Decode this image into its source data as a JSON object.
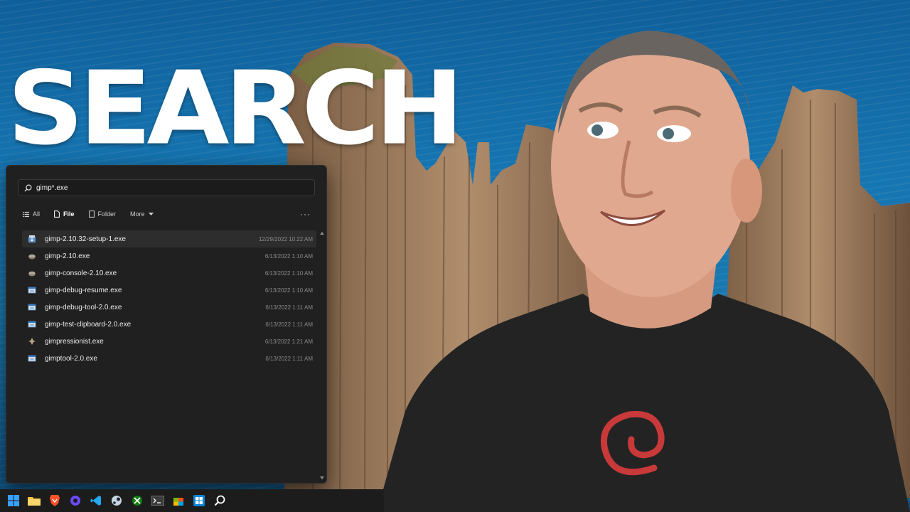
{
  "headline": "SEARCH",
  "search": {
    "query": "gimp*.exe",
    "placeholder": ""
  },
  "filters": [
    {
      "label": "All",
      "icon": "list-icon",
      "active": false
    },
    {
      "label": "File",
      "icon": "file-icon",
      "active": true
    },
    {
      "label": "Folder",
      "icon": "folder-icon",
      "active": false
    },
    {
      "label": "More",
      "icon": "chevron-down-icon",
      "active": false
    }
  ],
  "more_options": "···",
  "results": [
    {
      "name": "gimp-2.10.32-setup-1.exe",
      "date": "12/29/2022 10:22 AM",
      "icon": "installer-icon",
      "selected": true
    },
    {
      "name": "gimp-2.10.exe",
      "date": "6/13/2022 1:10 AM",
      "icon": "gimp-icon",
      "selected": false
    },
    {
      "name": "gimp-console-2.10.exe",
      "date": "6/13/2022 1:10 AM",
      "icon": "gimp-icon",
      "selected": false
    },
    {
      "name": "gimp-debug-resume.exe",
      "date": "6/13/2022 1:10 AM",
      "icon": "exe-icon",
      "selected": false
    },
    {
      "name": "gimp-debug-tool-2.0.exe",
      "date": "6/13/2022 1:11 AM",
      "icon": "exe-icon",
      "selected": false
    },
    {
      "name": "gimp-test-clipboard-2.0.exe",
      "date": "6/13/2022 1:11 AM",
      "icon": "exe-icon",
      "selected": false
    },
    {
      "name": "gimpressionist.exe",
      "date": "6/13/2022 1:21 AM",
      "icon": "gimpressionist-icon",
      "selected": false
    },
    {
      "name": "gimptool-2.0.exe",
      "date": "6/13/2022 1:11 AM",
      "icon": "exe-icon",
      "selected": false
    }
  ],
  "taskbar": [
    "windows-start-icon",
    "file-explorer-icon",
    "brave-browser-icon",
    "proton-icon",
    "vscode-icon",
    "steam-icon",
    "xbox-icon",
    "terminal-icon",
    "store-icon",
    "windows-app-icon",
    "search-icon"
  ],
  "colors": {
    "panel_bg": "#202020",
    "selected_row": "#2d2d2d",
    "sea": "#1676b2",
    "accent_blue": "#3aa0ff"
  }
}
